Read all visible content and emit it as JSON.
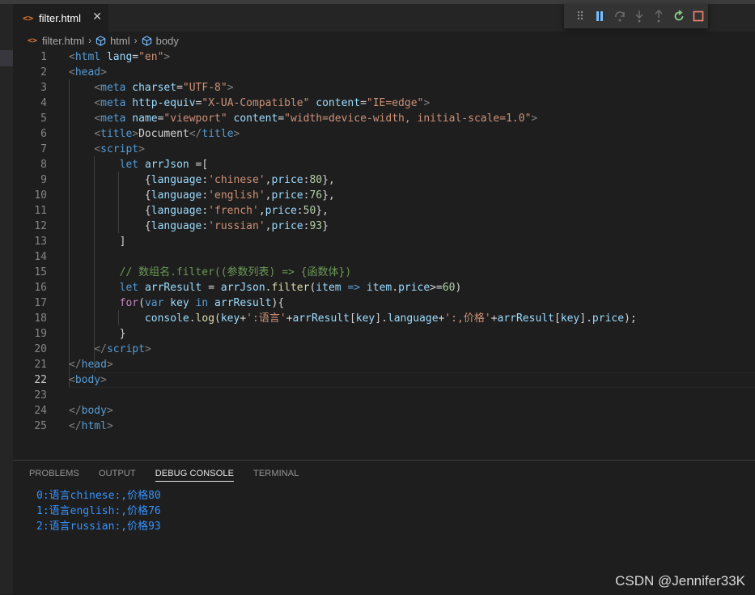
{
  "tab": {
    "icon": "html-file-icon",
    "icon_glyph": "<>",
    "label": "filter.html",
    "close": "✕"
  },
  "debug_toolbar": {
    "items": [
      "drag-handle-icon",
      "pause-icon",
      "step-over-icon",
      "step-into-icon",
      "step-out-icon",
      "restart-icon",
      "stop-icon"
    ]
  },
  "breadcrumb": {
    "file": "filter.html",
    "sep": "›",
    "items": [
      "html",
      "body"
    ]
  },
  "editor": {
    "current_line": 22,
    "lines": [
      {
        "n": "1",
        "tokens": [
          [
            "t-br",
            "<"
          ],
          [
            "t-tag",
            "html"
          ],
          [
            "t-txt",
            " "
          ],
          [
            "t-attr",
            "lang"
          ],
          [
            "t-txt",
            "="
          ],
          [
            "t-str",
            "\"en\""
          ],
          [
            "t-br",
            ">"
          ]
        ]
      },
      {
        "n": "2",
        "tokens": [
          [
            "t-br",
            "<"
          ],
          [
            "t-tag",
            "head"
          ],
          [
            "t-br",
            ">"
          ]
        ]
      },
      {
        "n": "3",
        "tokens": [
          [
            "t-txt",
            "    "
          ],
          [
            "t-br",
            "<"
          ],
          [
            "t-tag",
            "meta"
          ],
          [
            "t-txt",
            " "
          ],
          [
            "t-attr",
            "charset"
          ],
          [
            "t-txt",
            "="
          ],
          [
            "t-str",
            "\"UTF-8\""
          ],
          [
            "t-br",
            ">"
          ]
        ]
      },
      {
        "n": "4",
        "tokens": [
          [
            "t-txt",
            "    "
          ],
          [
            "t-br",
            "<"
          ],
          [
            "t-tag",
            "meta"
          ],
          [
            "t-txt",
            " "
          ],
          [
            "t-attr",
            "http-equiv"
          ],
          [
            "t-txt",
            "="
          ],
          [
            "t-str",
            "\"X-UA-Compatible\""
          ],
          [
            "t-txt",
            " "
          ],
          [
            "t-attr",
            "content"
          ],
          [
            "t-txt",
            "="
          ],
          [
            "t-str",
            "\"IE=edge\""
          ],
          [
            "t-br",
            ">"
          ]
        ]
      },
      {
        "n": "5",
        "tokens": [
          [
            "t-txt",
            "    "
          ],
          [
            "t-br",
            "<"
          ],
          [
            "t-tag",
            "meta"
          ],
          [
            "t-txt",
            " "
          ],
          [
            "t-attr",
            "name"
          ],
          [
            "t-txt",
            "="
          ],
          [
            "t-str",
            "\"viewport\""
          ],
          [
            "t-txt",
            " "
          ],
          [
            "t-attr",
            "content"
          ],
          [
            "t-txt",
            "="
          ],
          [
            "t-str",
            "\"width=device-width, initial-scale=1.0\""
          ],
          [
            "t-br",
            ">"
          ]
        ]
      },
      {
        "n": "6",
        "tokens": [
          [
            "t-txt",
            "    "
          ],
          [
            "t-br",
            "<"
          ],
          [
            "t-tag",
            "title"
          ],
          [
            "t-br",
            ">"
          ],
          [
            "t-txt",
            "Document"
          ],
          [
            "t-br",
            "</"
          ],
          [
            "t-tag",
            "title"
          ],
          [
            "t-br",
            ">"
          ]
        ]
      },
      {
        "n": "7",
        "tokens": [
          [
            "t-txt",
            "    "
          ],
          [
            "t-br",
            "<"
          ],
          [
            "t-tag",
            "script"
          ],
          [
            "t-br",
            ">"
          ]
        ]
      },
      {
        "n": "8",
        "tokens": [
          [
            "t-txt",
            "        "
          ],
          [
            "t-kw",
            "let"
          ],
          [
            "t-txt",
            " "
          ],
          [
            "t-var",
            "arrJson"
          ],
          [
            "t-txt",
            " =["
          ]
        ]
      },
      {
        "n": "9",
        "tokens": [
          [
            "t-txt",
            "            {"
          ],
          [
            "t-var",
            "language"
          ],
          [
            "t-txt",
            ":"
          ],
          [
            "t-str",
            "'chinese'"
          ],
          [
            "t-txt",
            ","
          ],
          [
            "t-var",
            "price"
          ],
          [
            "t-txt",
            ":"
          ],
          [
            "t-num",
            "80"
          ],
          [
            "t-txt",
            "},"
          ]
        ]
      },
      {
        "n": "10",
        "tokens": [
          [
            "t-txt",
            "            {"
          ],
          [
            "t-var",
            "language"
          ],
          [
            "t-txt",
            ":"
          ],
          [
            "t-str",
            "'english'"
          ],
          [
            "t-txt",
            ","
          ],
          [
            "t-var",
            "price"
          ],
          [
            "t-txt",
            ":"
          ],
          [
            "t-num",
            "76"
          ],
          [
            "t-txt",
            "},"
          ]
        ]
      },
      {
        "n": "11",
        "tokens": [
          [
            "t-txt",
            "            {"
          ],
          [
            "t-var",
            "language"
          ],
          [
            "t-txt",
            ":"
          ],
          [
            "t-str",
            "'french'"
          ],
          [
            "t-txt",
            ","
          ],
          [
            "t-var",
            "price"
          ],
          [
            "t-txt",
            ":"
          ],
          [
            "t-num",
            "50"
          ],
          [
            "t-txt",
            "},"
          ]
        ]
      },
      {
        "n": "12",
        "tokens": [
          [
            "t-txt",
            "            {"
          ],
          [
            "t-var",
            "language"
          ],
          [
            "t-txt",
            ":"
          ],
          [
            "t-str",
            "'russian'"
          ],
          [
            "t-txt",
            ","
          ],
          [
            "t-var",
            "price"
          ],
          [
            "t-txt",
            ":"
          ],
          [
            "t-num",
            "93"
          ],
          [
            "t-txt",
            "}"
          ]
        ]
      },
      {
        "n": "13",
        "tokens": [
          [
            "t-txt",
            "        ]"
          ]
        ]
      },
      {
        "n": "14",
        "tokens": []
      },
      {
        "n": "15",
        "tokens": [
          [
            "t-txt",
            "        "
          ],
          [
            "t-cm",
            "// 数组名.filter((参数列表) => {函数体})"
          ]
        ]
      },
      {
        "n": "16",
        "tokens": [
          [
            "t-txt",
            "        "
          ],
          [
            "t-kw",
            "let"
          ],
          [
            "t-txt",
            " "
          ],
          [
            "t-var",
            "arrResult"
          ],
          [
            "t-txt",
            " = "
          ],
          [
            "t-var",
            "arrJson"
          ],
          [
            "t-txt",
            "."
          ],
          [
            "t-fn",
            "filter"
          ],
          [
            "t-txt",
            "("
          ],
          [
            "t-var",
            "item"
          ],
          [
            "t-txt",
            " "
          ],
          [
            "t-kw",
            "=>"
          ],
          [
            "t-txt",
            " "
          ],
          [
            "t-var",
            "item"
          ],
          [
            "t-txt",
            "."
          ],
          [
            "t-var",
            "price"
          ],
          [
            "t-txt",
            ">="
          ],
          [
            "t-num",
            "60"
          ],
          [
            "t-txt",
            ")"
          ]
        ]
      },
      {
        "n": "17",
        "tokens": [
          [
            "t-txt",
            "        "
          ],
          [
            "t-ctl",
            "for"
          ],
          [
            "t-txt",
            "("
          ],
          [
            "t-kw",
            "var"
          ],
          [
            "t-txt",
            " "
          ],
          [
            "t-var",
            "key"
          ],
          [
            "t-txt",
            " "
          ],
          [
            "t-kw",
            "in"
          ],
          [
            "t-txt",
            " "
          ],
          [
            "t-var",
            "arrResult"
          ],
          [
            "t-txt",
            "){"
          ]
        ]
      },
      {
        "n": "18",
        "tokens": [
          [
            "t-txt",
            "            "
          ],
          [
            "t-var",
            "console"
          ],
          [
            "t-txt",
            "."
          ],
          [
            "t-fn",
            "log"
          ],
          [
            "t-txt",
            "("
          ],
          [
            "t-var",
            "key"
          ],
          [
            "t-txt",
            "+"
          ],
          [
            "t-str",
            "':语言'"
          ],
          [
            "t-txt",
            "+"
          ],
          [
            "t-var",
            "arrResult"
          ],
          [
            "t-txt",
            "["
          ],
          [
            "t-var",
            "key"
          ],
          [
            "t-txt",
            "]."
          ],
          [
            "t-var",
            "language"
          ],
          [
            "t-txt",
            "+"
          ],
          [
            "t-str",
            "':,价格'"
          ],
          [
            "t-txt",
            "+"
          ],
          [
            "t-var",
            "arrResult"
          ],
          [
            "t-txt",
            "["
          ],
          [
            "t-var",
            "key"
          ],
          [
            "t-txt",
            "]."
          ],
          [
            "t-var",
            "price"
          ],
          [
            "t-txt",
            ");"
          ]
        ]
      },
      {
        "n": "19",
        "tokens": [
          [
            "t-txt",
            "        }"
          ]
        ]
      },
      {
        "n": "20",
        "tokens": [
          [
            "t-txt",
            "    "
          ],
          [
            "t-br",
            "</"
          ],
          [
            "t-tag",
            "script"
          ],
          [
            "t-br",
            ">"
          ]
        ]
      },
      {
        "n": "21",
        "tokens": [
          [
            "t-br",
            "</"
          ],
          [
            "t-tag",
            "head"
          ],
          [
            "t-br",
            ">"
          ]
        ]
      },
      {
        "n": "22",
        "tokens": [
          [
            "t-br",
            "<"
          ],
          [
            "t-tag",
            "body"
          ],
          [
            "t-br",
            ">"
          ]
        ]
      },
      {
        "n": "23",
        "tokens": []
      },
      {
        "n": "24",
        "tokens": [
          [
            "t-br",
            "</"
          ],
          [
            "t-tag",
            "body"
          ],
          [
            "t-br",
            ">"
          ]
        ]
      },
      {
        "n": "25",
        "tokens": [
          [
            "t-br",
            "</"
          ],
          [
            "t-tag",
            "html"
          ],
          [
            "t-br",
            ">"
          ]
        ]
      }
    ]
  },
  "panel": {
    "tabs": [
      {
        "label": "PROBLEMS",
        "active": false
      },
      {
        "label": "OUTPUT",
        "active": false
      },
      {
        "label": "DEBUG CONSOLE",
        "active": true
      },
      {
        "label": "TERMINAL",
        "active": false
      }
    ],
    "console_output": [
      "0:语言chinese:,价格80",
      "1:语言english:,价格76",
      "2:语言russian:,价格93"
    ]
  },
  "watermark": "CSDN @Jennifer33K",
  "colors": {
    "accent": "#3794ff",
    "editor_bg": "#1e1e1e",
    "restart": "#89d185",
    "stop": "#f48771",
    "pause": "#75beff"
  }
}
